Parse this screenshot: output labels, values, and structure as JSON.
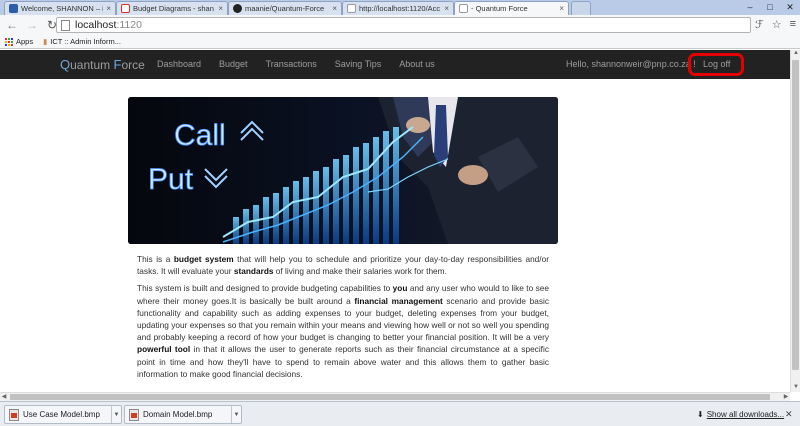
{
  "browser": {
    "tabs": [
      {
        "title": "Welcome, SHANNON – ill",
        "icon": "outlook-icon",
        "color": "#2a5caa",
        "active": false
      },
      {
        "title": "Budget Diagrams - shan",
        "icon": "gmail-icon",
        "color": "#d93025",
        "active": false
      },
      {
        "title": "maanie/Quantum-Force",
        "icon": "github-icon",
        "color": "#222222",
        "active": false
      },
      {
        "title": "http://localhost:1120/Acc",
        "icon": "page-icon",
        "color": "#999999",
        "active": false
      },
      {
        "title": "- Quantum Force",
        "icon": "page-icon",
        "color": "#999999",
        "active": true
      }
    ],
    "url_host": "localhost",
    "url_port": ":1120",
    "bookmarks": [
      {
        "label": "Apps",
        "icon": "apps-grid-icon"
      },
      {
        "label": "ICT :: Admin Inform...",
        "icon": "bookmark-icon"
      }
    ]
  },
  "site": {
    "brand_q": "Q",
    "brand_uantum": "uantum ",
    "brand_f": "F",
    "brand_orce": "orce",
    "nav": [
      "Dashboard",
      "Budget",
      "Transactions",
      "Saving Tips",
      "About us"
    ],
    "greeting": "Hello, shannonweir@pnp.co.za !",
    "logoff": "Log off"
  },
  "hero": {
    "call": "Call",
    "put": "Put"
  },
  "content": {
    "p1": [
      {
        "t": "This is a "
      },
      {
        "t": "budget system",
        "b": true
      },
      {
        "t": " that will help you to schedule and prioritize your day-to-day responsibilities and/or tasks. It will evaluate your "
      },
      {
        "t": "standards",
        "b": true
      },
      {
        "t": " of living and make their salaries work for them."
      }
    ],
    "p2": [
      {
        "t": "This system is built and designed to provide budgeting capabilities to "
      },
      {
        "t": "you",
        "b": true
      },
      {
        "t": " and any user who would to like to see where their money goes.It is basically be built around a "
      },
      {
        "t": "financial management",
        "b": true
      },
      {
        "t": " scenario and provide basic functionality and capability such as adding expenses to your budget, deleting expenses from your budget, updating your expenses so that you remain within your means and viewing how well or not so well you spending and probably keeping a record of how your budget is changing to better your financial position. It will be a very "
      },
      {
        "t": "powerful tool",
        "b": true
      },
      {
        "t": " in that it allows the user to generate reports such as their financial circumstance at a specific point in time and how they'll have to spend to remain above water and this allows them to gather basic information to make good financial decisions."
      }
    ]
  },
  "downloads": {
    "items": [
      "Use Case Model.bmp",
      "Domain Model.bmp"
    ],
    "show_all": "Show all downloads..."
  },
  "colors": {
    "navbar": "#222222",
    "highlight": "#e50000",
    "brand_accent": "#6fa8dc"
  }
}
